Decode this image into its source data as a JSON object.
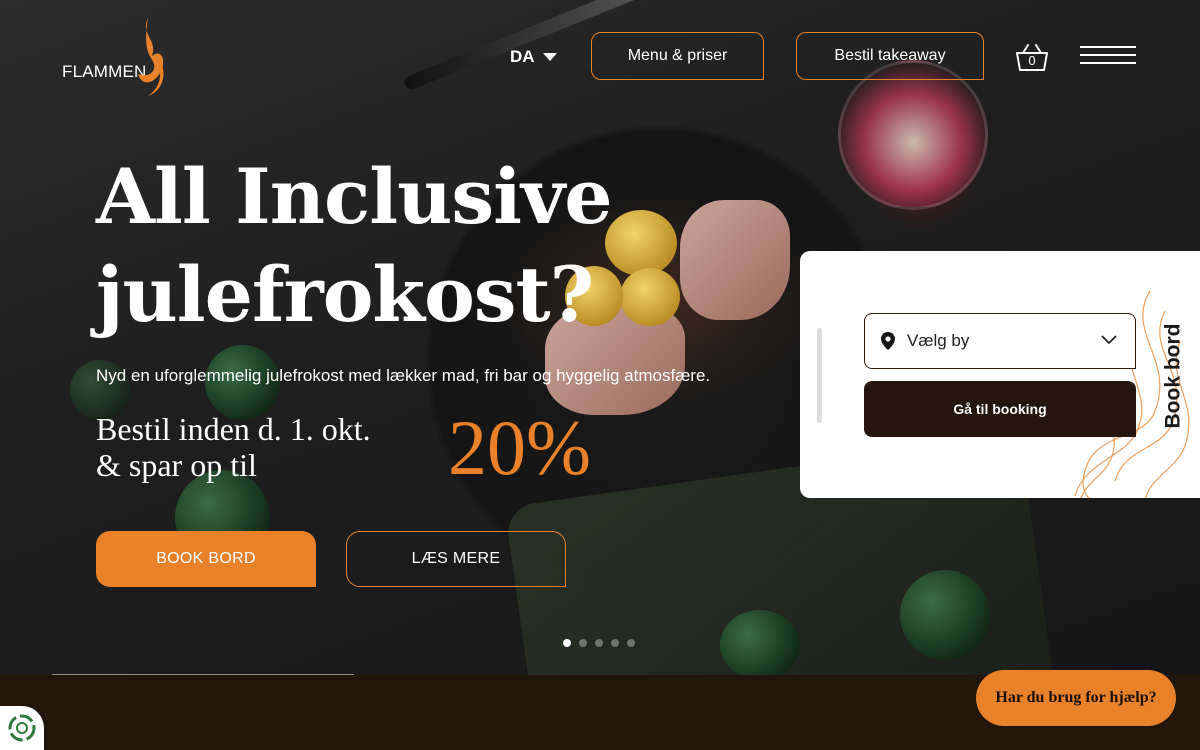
{
  "brand": {
    "name": "FLAMMEN",
    "accent": "#e8812a",
    "dark": "#24160c"
  },
  "header": {
    "language": "DA",
    "nav_menu": "Menu & priser",
    "nav_takeaway": "Bestil takeaway",
    "basket_count": "0",
    "icons": [
      "basket-icon",
      "hamburger-menu-icon",
      "chevron-down-icon"
    ]
  },
  "hero": {
    "headline": "All Inclusive julefrokost?",
    "subline": "Nyd en uforglemmelig julefrokost med lækker mad, fri bar og hyggelig atmosfære.",
    "offer_line1": "Bestil inden d. 1. okt.",
    "offer_line2": "& spar op til",
    "percent": "20%",
    "btn_book": "BOOK BORD",
    "btn_more": "LÆS MERE",
    "slides_total": 5,
    "slide_active": 1
  },
  "booking": {
    "city_placeholder": "Vælg by",
    "go_button": "Gå til booking",
    "side_label": "Book bord"
  },
  "help": {
    "label": "Har du brug for hjælp?"
  }
}
